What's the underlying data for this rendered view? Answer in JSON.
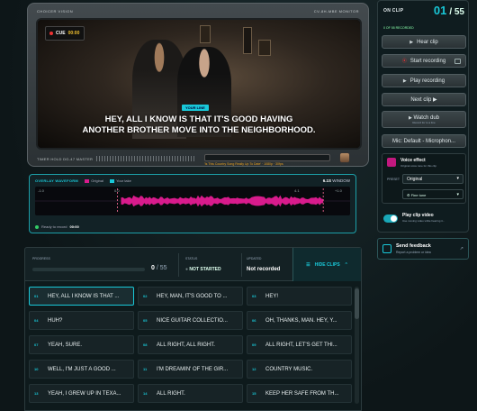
{
  "monitor": {
    "top_left": "CHOICER VISION",
    "top_right": "CV-8H-MBE MONITOR",
    "cue_label": "CUE",
    "timecode": "00:00",
    "your_line": "YOUR LINE",
    "subtitle": "HEY, ALL I KNOW IS THAT IT'S GOOD HAVING\nANOTHER BROTHER MOVE INTO THE NEIGHBORHOOD.",
    "bottom_label": "TIMER HOLD   DG-47 MASTER",
    "bottom_note": "'Is This Country Song Really Up To Date' · 1080p · 30fps"
  },
  "waveform": {
    "title": "OVERLAY WAVEFORM",
    "legend": [
      "Original",
      "Your take"
    ],
    "window_value": "6.1S",
    "window_label": "WINDOW",
    "ticks": [
      "-1.0",
      "0.0",
      "4.1",
      "+1.0"
    ],
    "status": "Ready to record",
    "status_time": "00:00"
  },
  "clip_panel": {
    "label": "ON CLIP",
    "current": "01",
    "total": "55",
    "recorded": "0 OF 55 RECORDED",
    "buttons": [
      {
        "icon": "▶",
        "label": "Hear clip"
      },
      {
        "icon": "⦿",
        "label": "Start recording"
      },
      {
        "icon": "▶",
        "label": "Play recording"
      },
      {
        "icon": "",
        "label": "Next clip ▶"
      },
      {
        "icon": "▶",
        "label": "Watch dub",
        "sub": "Record for to a line"
      },
      {
        "icon": "",
        "label": "Mic: Default - Microphon..."
      }
    ],
    "voice": {
      "title": "Voice effect",
      "sub": "Original voice tone for this clip",
      "preset_label": "PRESET",
      "preset": "Original",
      "fine": "Fine tune"
    },
    "play_video": {
      "title": "Play clip video",
      "sub": "Use moving video while hearing it..."
    }
  },
  "feedback": {
    "title": "Send feedback",
    "sub": "Report a problem or idea"
  },
  "progress": {
    "label": "PROGRESS",
    "value": 0,
    "count": "0",
    "total": "/ 55",
    "status_label": "STATUS",
    "status": "NOT STARTED",
    "updated_label": "UPDATED",
    "updated": "Not recorded",
    "nav_label": "HIDE CLIPS"
  },
  "clips": [
    {
      "n": "01",
      "text": "HEY, ALL I KNOW IS THAT ..."
    },
    {
      "n": "02",
      "text": "HEY, MAN, IT'S GOOD TO ..."
    },
    {
      "n": "03",
      "text": "HEY!"
    },
    {
      "n": "04",
      "text": "HUH?"
    },
    {
      "n": "05",
      "text": "NICE GUITAR COLLECTIO..."
    },
    {
      "n": "06",
      "text": "OH, THANKS, MAN. HEY, Y..."
    },
    {
      "n": "07",
      "text": "YEAH, SURE."
    },
    {
      "n": "08",
      "text": "ALL RIGHT, ALL RIGHT."
    },
    {
      "n": "09",
      "text": "ALL RIGHT, LET'S GET THI..."
    },
    {
      "n": "10",
      "text": "WELL, I'M JUST A GOOD ..."
    },
    {
      "n": "11",
      "text": "I'M DREAMIN' OF THE GIR..."
    },
    {
      "n": "12",
      "text": "COUNTRY MUSIC."
    },
    {
      "n": "13",
      "text": "YEAH, I GREW UP IN TEXA..."
    },
    {
      "n": "14",
      "text": "ALL RIGHT."
    },
    {
      "n": "15",
      "text": "KEEP HER SAFE FROM TH..."
    }
  ],
  "colors": {
    "accent": "#19c8d8",
    "original": "#d81b8c",
    "take": "#19c8d8",
    "record": "#e33333"
  }
}
